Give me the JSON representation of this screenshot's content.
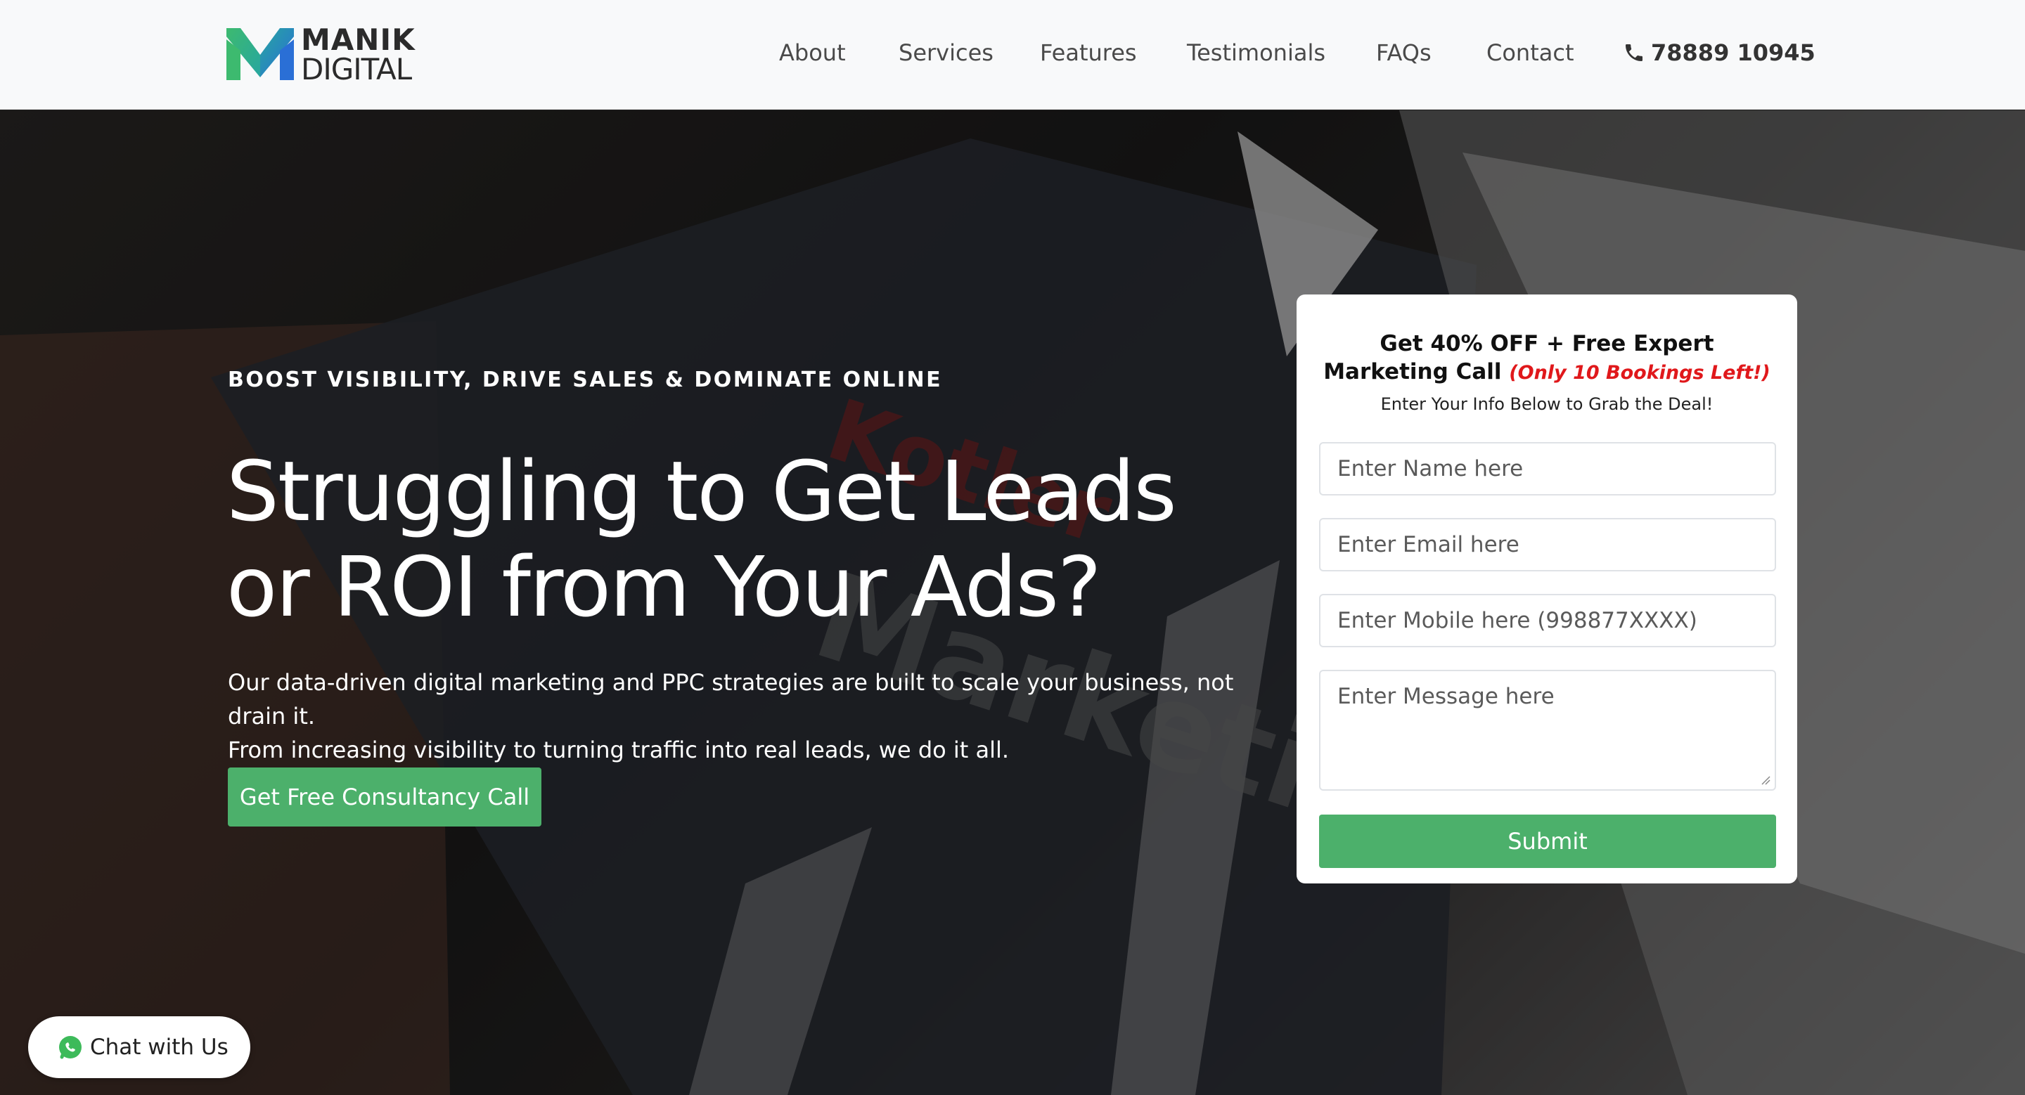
{
  "brand": {
    "name_top": "MANIK",
    "name_bottom": "DIGITAL",
    "colors": {
      "green": "#3dba6f",
      "blue": "#2a6fd6",
      "teal": "#27a6a0"
    }
  },
  "nav": {
    "items": [
      {
        "label": "About"
      },
      {
        "label": "Services"
      },
      {
        "label": "Features"
      },
      {
        "label": "Testimonials"
      },
      {
        "label": "FAQs"
      },
      {
        "label": "Contact"
      }
    ],
    "phone": "78889 10945",
    "phone_icon": "phone-icon"
  },
  "hero": {
    "eyebrow": "BOOST VISIBILITY, DRIVE SALES & DOMINATE ONLINE",
    "headline": "Struggling to Get Leads or ROI from Your Ads?",
    "subtext_line1": "Our data-driven digital marketing and PPC strategies are built to scale your business, not drain it.",
    "subtext_line2": "From increasing visibility to turning traffic into real leads, we do it all.",
    "cta_label": "Get Free Consultancy Call",
    "accent_color": "#4cb06b"
  },
  "form": {
    "title_main": "Get 40% OFF + Free Expert Marketing Call",
    "title_highlight": "(Only 10 Bookings Left!)",
    "highlight_color": "#e0181b",
    "subtitle": "Enter Your Info Below to Grab the Deal!",
    "name_placeholder": "Enter Name here",
    "email_placeholder": "Enter Email here",
    "mobile_placeholder": "Enter Mobile here (998877XXXX)",
    "message_placeholder": "Enter Message here",
    "submit_label": "Submit"
  },
  "chat": {
    "label": "Chat with Us",
    "icon": "whatsapp-icon"
  }
}
